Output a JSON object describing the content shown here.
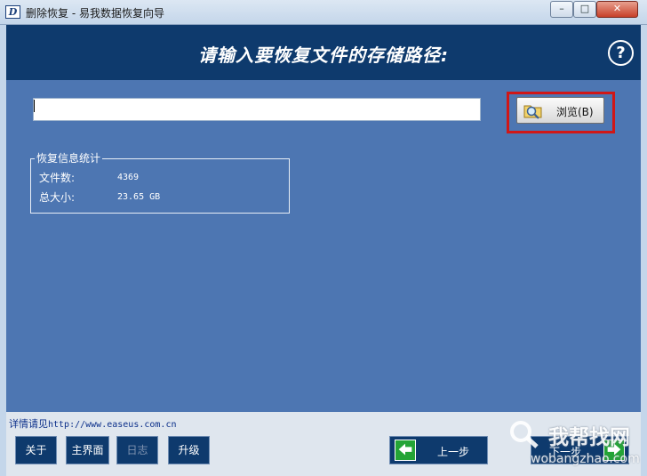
{
  "window": {
    "title": "删除恢复 - 易我数据恢复向导",
    "app_icon_letter": "D",
    "minimize_symbol": "–",
    "maximize_symbol": "□",
    "close_symbol": "✕"
  },
  "header": {
    "title": "请输入要恢复文件的存储路径:",
    "help_symbol": "?"
  },
  "path_input": {
    "value": "",
    "placeholder": ""
  },
  "browse_button": {
    "label": "浏览(B)",
    "icon": "folder-search-icon"
  },
  "stats": {
    "legend": "恢复信息统计",
    "file_count_label": "文件数:",
    "file_count_value": "4369",
    "total_size_label": "总大小:",
    "total_size_value": "23.65 GB"
  },
  "footer": {
    "detail_label": "详情请见",
    "detail_url": "http://www.easeus.com.cn",
    "buttons": {
      "about": "关于",
      "main_menu": "主界面",
      "log": "日志",
      "upgrade": "升级",
      "prev": "上一步",
      "next": "下一步"
    }
  },
  "watermark": {
    "main": "我帮找网",
    "url": "wobangzhao.com"
  },
  "colors": {
    "header_bg": "#0e3a6d",
    "main_bg": "#4d76b2",
    "highlight": "#d01717",
    "arrow_green": "#24a436"
  }
}
